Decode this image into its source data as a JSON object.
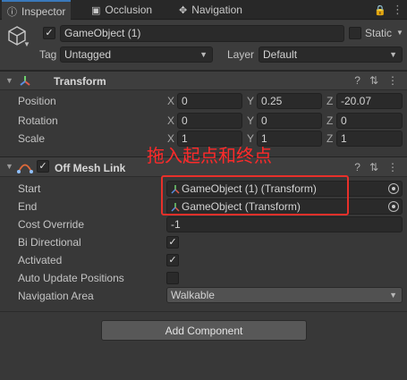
{
  "tabs": [
    {
      "label": "Inspector",
      "icon": "info-icon"
    },
    {
      "label": "Occlusion",
      "icon": "occlusion-icon"
    },
    {
      "label": "Navigation",
      "icon": "navigation-icon"
    }
  ],
  "header": {
    "object_name": "GameObject (1)",
    "static_label": "Static",
    "tag_label": "Tag",
    "tag_value": "Untagged",
    "layer_label": "Layer",
    "layer_value": "Default"
  },
  "transform": {
    "title": "Transform",
    "rows": [
      {
        "label": "Position",
        "x": "0",
        "y": "0.25",
        "z": "-20.07"
      },
      {
        "label": "Rotation",
        "x": "0",
        "y": "0",
        "z": "0"
      },
      {
        "label": "Scale",
        "x": "1",
        "y": "1",
        "z": "1"
      }
    ],
    "axis": {
      "x": "X",
      "y": "Y",
      "z": "Z"
    }
  },
  "offmesh": {
    "title": "Off Mesh Link",
    "start_label": "Start",
    "start_value": "GameObject (1) (Transform)",
    "end_label": "End",
    "end_value": "GameObject (Transform)",
    "cost_label": "Cost Override",
    "cost_value": "-1",
    "bidir_label": "Bi Directional",
    "activated_label": "Activated",
    "auto_label": "Auto Update Positions",
    "area_label": "Navigation Area",
    "area_value": "Walkable"
  },
  "annotation": "拖入起点和终点",
  "add_component": "Add Component",
  "colors": {
    "highlight": "#e8302a",
    "annotation": "#ff2a2a",
    "accent": "#3a79bb"
  }
}
